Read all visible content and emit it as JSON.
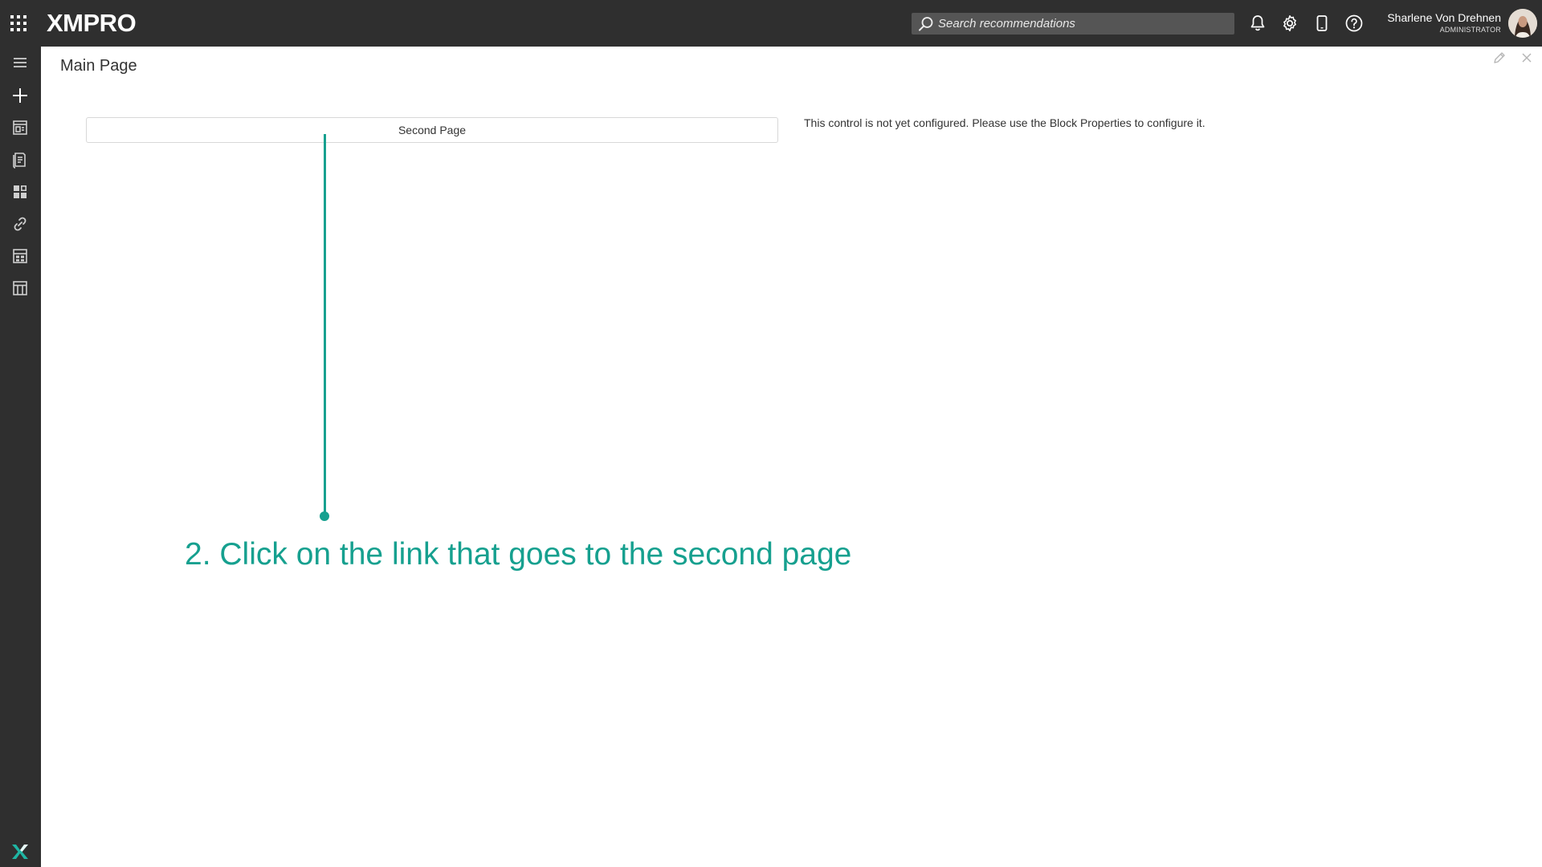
{
  "header": {
    "logo_text": "XMPRO",
    "search_placeholder": "Search recommendations",
    "user_name": "Sharlene Von Drehnen",
    "user_role": "ADMINISTRATOR",
    "icons": [
      "apps-grid-icon",
      "search-icon",
      "bell-icon",
      "gear-icon",
      "mobile-device-icon",
      "help-icon"
    ]
  },
  "sidebar": {
    "icons": [
      "hamburger-menu-icon",
      "plus-icon",
      "app-page-icon",
      "recommendations-icon",
      "dashboard-blocks-icon",
      "link-icon",
      "calculator-icon",
      "data-table-icon",
      "xmpro-x-logo-icon"
    ]
  },
  "page": {
    "title": "Main Page",
    "link_button_label": "Second Page",
    "unconfigured_message": "This control is not yet configured. Please use the Block Properties to configure it."
  },
  "annotation": {
    "text": "2. Click on the link that goes to the second page",
    "color": "#16a08f"
  },
  "colors": {
    "topbar": "#2f2f2f",
    "search_bg": "#555555",
    "accent": "#16a08f",
    "logo_x": "#1fb5a3"
  }
}
